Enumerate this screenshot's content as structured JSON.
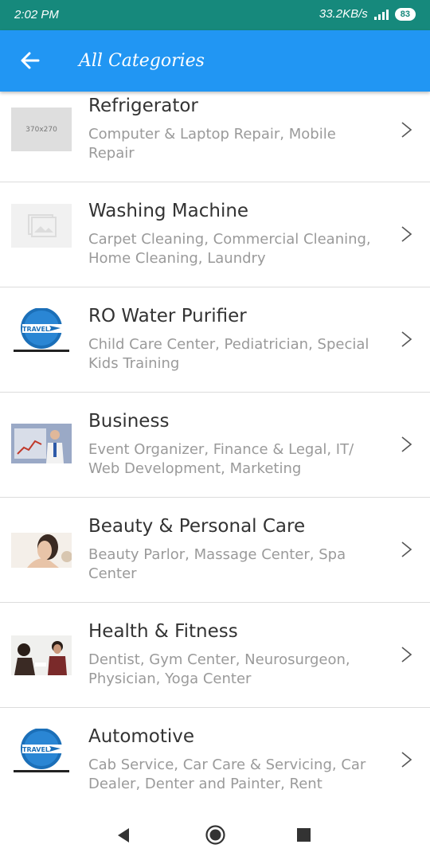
{
  "status": {
    "time": "2:02 PM",
    "speed": "33.2KB/s",
    "battery": "83"
  },
  "appbar": {
    "title": "All Categories"
  },
  "categories": [
    {
      "name": "Refrigerator",
      "services": "Computer & Laptop Repair, Mobile Repair",
      "thumb": "placeholder-370x270",
      "thumb_text": "370x270"
    },
    {
      "name": "Washing Machine",
      "services": "Carpet Cleaning, Commercial Cleaning, Home Cleaning, Laundry",
      "thumb": "image-placeholder"
    },
    {
      "name": "RO Water Purifier",
      "services": "Child Care Center, Pediatrician, Special Kids Training",
      "thumb": "travel-logo",
      "thumb_text": "TRAVEL"
    },
    {
      "name": "Business",
      "services": "Event Organizer, Finance & Legal, IT/ Web Development, Marketing",
      "thumb": "business-photo"
    },
    {
      "name": "Beauty & Personal Care",
      "services": "Beauty Parlor, Massage Center, Spa Center",
      "thumb": "beauty-photo"
    },
    {
      "name": "Health & Fitness",
      "services": "Dentist, Gym Center, Neurosurgeon, Physician, Yoga Center",
      "thumb": "health-photo"
    },
    {
      "name": "Automotive",
      "services": "Cab Service, Car Care & Servicing, Car Dealer, Denter and Painter, Rent",
      "thumb": "travel-logo",
      "thumb_text": "TRAVEL"
    }
  ],
  "navbar": {
    "icons": [
      "back-triangle-icon",
      "home-circle-icon",
      "recents-square-icon"
    ]
  }
}
